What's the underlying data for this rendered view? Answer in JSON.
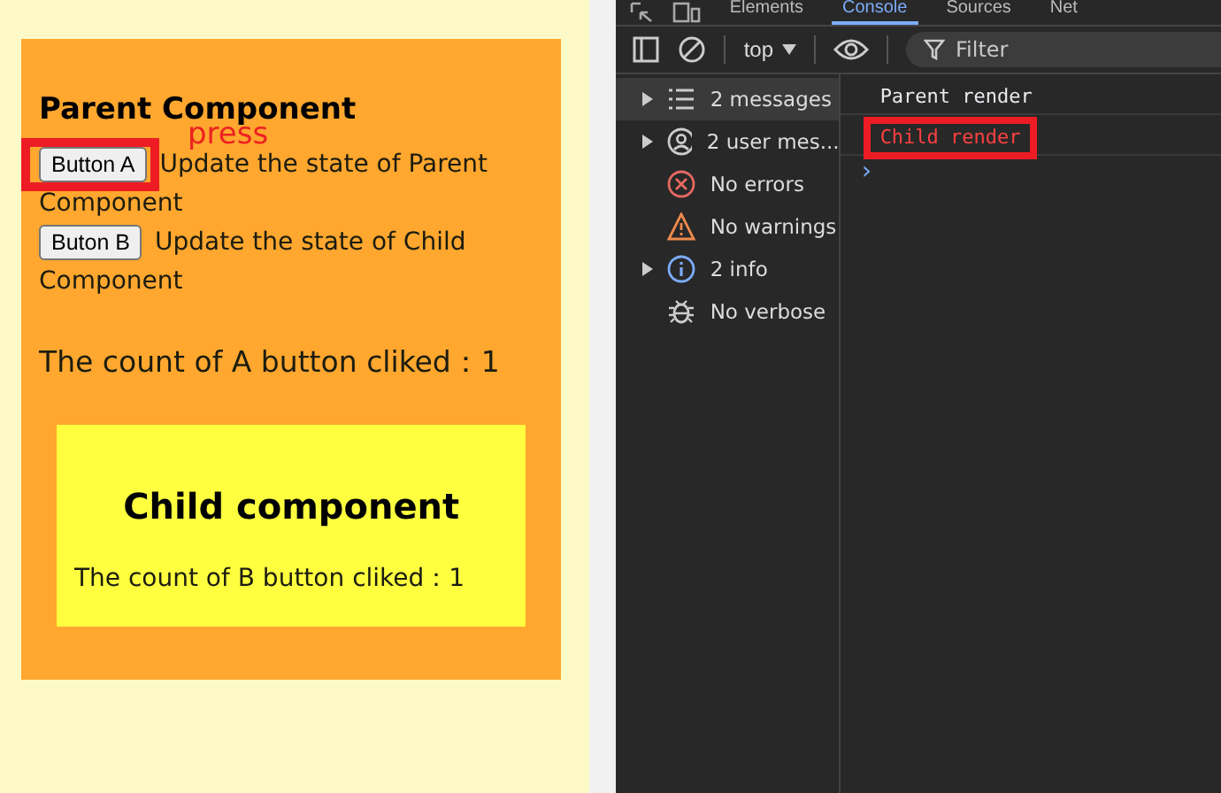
{
  "parent": {
    "title": "Parent Component",
    "annotation": "press",
    "count_text": "The count of A button cliked：1",
    "actions": [
      {
        "button": "Button A",
        "description_lines": [
          "Update the state of Parent",
          "Component"
        ],
        "highlighted": true
      },
      {
        "button": "Buton B",
        "description_lines": [
          "Update the state of Child",
          "Component"
        ],
        "highlighted": false
      }
    ]
  },
  "child": {
    "title": "Child component",
    "count_text": "The count of B button cliked：1"
  },
  "devtools": {
    "context": "top",
    "filter_placeholder": "Filter",
    "prompt": "›",
    "tabs": [
      {
        "label": "Elements",
        "selected": false
      },
      {
        "label": "Console",
        "selected": true
      },
      {
        "label": "Sources",
        "selected": false
      },
      {
        "label": "Net",
        "selected": false
      }
    ],
    "sidebar": [
      {
        "kind": "list",
        "label": "2 messages",
        "expandable": true,
        "selected": true
      },
      {
        "kind": "user",
        "label": "2 user mes...",
        "expandable": true,
        "selected": false
      },
      {
        "kind": "error",
        "label": "No errors",
        "expandable": false,
        "selected": false
      },
      {
        "kind": "warning",
        "label": "No warnings",
        "expandable": false,
        "selected": false
      },
      {
        "kind": "info",
        "label": "2 info",
        "expandable": true,
        "selected": false
      },
      {
        "kind": "verbose",
        "label": "No verbose",
        "expandable": false,
        "selected": false
      }
    ],
    "messages": [
      {
        "text": "Parent render",
        "highlighted": false,
        "color": "#e8eaed"
      },
      {
        "text": "Child render",
        "highlighted": true,
        "color": "#ff4040"
      }
    ]
  }
}
